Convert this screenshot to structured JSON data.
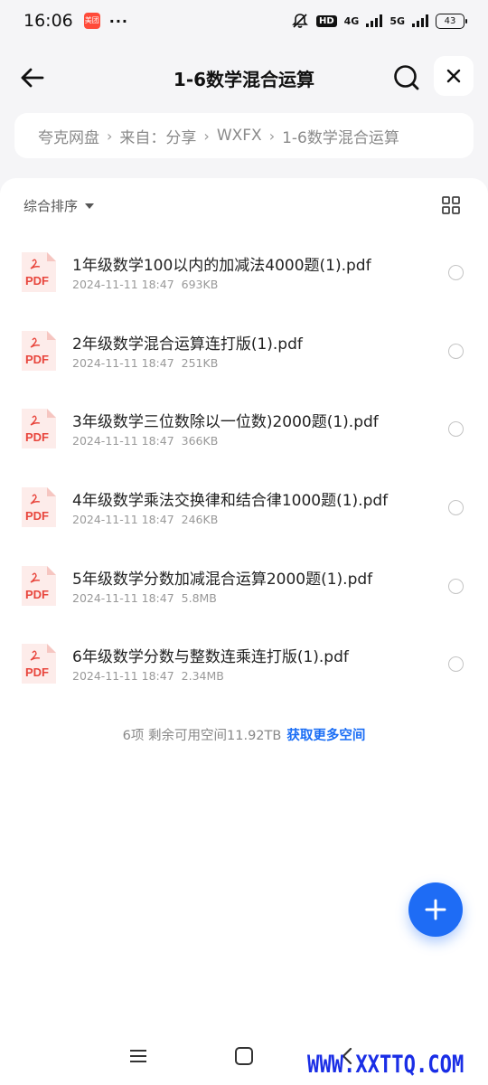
{
  "status_bar": {
    "time": "16:06",
    "app_badge": "美团",
    "dots": "···",
    "hd": "HD",
    "net1": "4G",
    "net2": "5G",
    "battery": "43"
  },
  "header": {
    "title": "1-6数学混合运算"
  },
  "breadcrumb": {
    "items": [
      "夸克网盘",
      "来自：分享",
      "WXFX",
      "1-6数学混合运算"
    ],
    "separator": "›"
  },
  "toolbar": {
    "sort_label": "综合排序"
  },
  "files": [
    {
      "name": "1年级数学100以内的加减法4000题(1).pdf",
      "date": "2024-11-11 18:47",
      "size": "693KB",
      "icon_label": "PDF"
    },
    {
      "name": "2年级数学混合运算连打版(1).pdf",
      "date": "2024-11-11 18:47",
      "size": "251KB",
      "icon_label": "PDF"
    },
    {
      "name": "3年级数学三位数除以一位数)2000题(1).pdf",
      "date": "2024-11-11 18:47",
      "size": "366KB",
      "icon_label": "PDF"
    },
    {
      "name": "4年级数学乘法交换律和结合律1000题(1).pdf",
      "date": "2024-11-11 18:47",
      "size": "246KB",
      "icon_label": "PDF"
    },
    {
      "name": "5年级数学分数加减混合运算2000题(1).pdf",
      "date": "2024-11-11 18:47",
      "size": "5.8MB",
      "icon_label": "PDF"
    },
    {
      "name": "6年级数学分数与整数连乘连打版(1).pdf",
      "date": "2024-11-11 18:47",
      "size": "2.34MB",
      "icon_label": "PDF"
    }
  ],
  "footer": {
    "summary": "6项 剩余可用空间11.92TB",
    "link": "获取更多空间"
  },
  "watermark": "WWW.XXTTQ.COM",
  "colors": {
    "accent": "#1e6cf5",
    "pdf_red": "#e8453c",
    "background": "#f5f5f7"
  }
}
